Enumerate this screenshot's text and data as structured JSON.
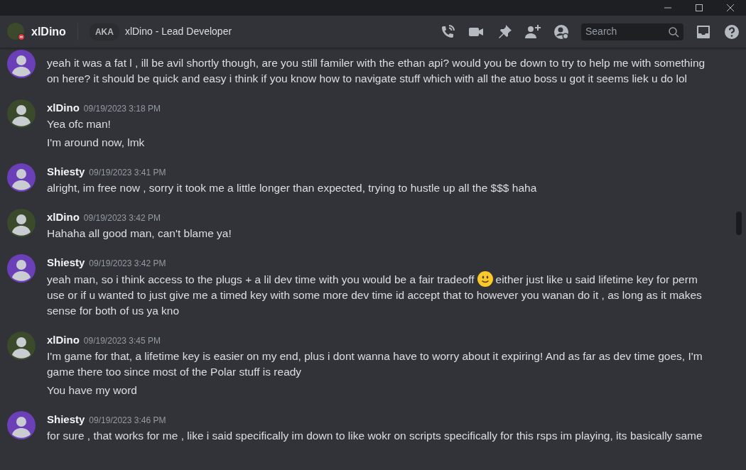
{
  "header": {
    "username": "xlDino",
    "aka_label": "AKA",
    "nickname": "xlDino - Lead Developer",
    "search": {
      "placeholder": "Search"
    }
  },
  "groups": [
    {
      "color": "#6a3fb8",
      "messages": [
        [
          {
            "kind": "text",
            "text": "yeah it was a fat l , ill be avil shortly though, are you still familer with the ethan api? would you be down to try to help me with something on here? it should be quick and easy i think if you know how to navigate stuff which with all the atuo boss u got it seems liek u do lol"
          }
        ]
      ]
    },
    {
      "color": "#3b4a2a",
      "author": "xlDino",
      "timestamp": "09/19/2023 3:18 PM",
      "messages": [
        [
          {
            "kind": "text",
            "text": "Yea ofc man!"
          }
        ],
        [
          {
            "kind": "text",
            "text": "I'm around now, lmk"
          }
        ]
      ]
    },
    {
      "color": "#6a3fb8",
      "author": "Shiesty",
      "timestamp": "09/19/2023 3:41 PM",
      "messages": [
        [
          {
            "kind": "text",
            "text": "alright, im free now , sorry it took me a little longer than expected, trying to hustle up all the $$$ haha"
          }
        ]
      ]
    },
    {
      "color": "#3b4a2a",
      "author": "xlDino",
      "timestamp": "09/19/2023 3:42 PM",
      "messages": [
        [
          {
            "kind": "text",
            "text": "Hahaha all good man, can't blame ya!"
          }
        ]
      ]
    },
    {
      "color": "#6a3fb8",
      "author": "Shiesty",
      "timestamp": "09/19/2023 3:42 PM",
      "messages": [
        [
          {
            "kind": "text",
            "text": "yeah man, so i think  access to the plugs + a lil dev time with you would be a fair tradeoff"
          },
          {
            "kind": "emoji"
          },
          {
            "kind": "text",
            "text": "either just like u said lifetime key for perm use or if u wanted to just give me a timed key with some more dev time id accept that to however you wanan do it , as long as it makes sense for both of us ya kno"
          }
        ]
      ]
    },
    {
      "color": "#3b4a2a",
      "author": "xlDino",
      "timestamp": "09/19/2023 3:45 PM",
      "messages": [
        [
          {
            "kind": "text",
            "text": "I'm game for that, a lifetime key is easier on my end, plus i dont wanna have to worry about it expiring! And as far as dev time goes,  I'm game there too since most of the Polar stuff is ready"
          }
        ],
        [
          {
            "kind": "text",
            "text": "You have my word"
          }
        ]
      ]
    },
    {
      "color": "#6a3fb8",
      "author": "Shiesty",
      "timestamp": "09/19/2023 3:46 PM",
      "messages": [
        [
          {
            "kind": "text",
            "text": "for sure , that works for me , like i said specifically im down to like wokr on scripts specifically for this rsps im playing, its basically same"
          }
        ]
      ]
    }
  ]
}
